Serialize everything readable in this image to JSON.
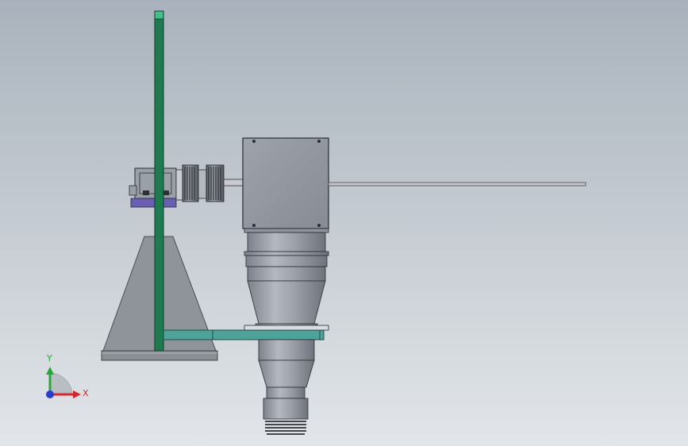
{
  "viewport": {
    "background_top": "#a9b2bc",
    "background_bottom": "#e2e6ea"
  },
  "colors": {
    "post": "#1f7a4f",
    "post_top": "#45c08a",
    "cross_arm": "#4da39a",
    "mount_block": "#6a5fb5",
    "base_plate": "#8a8f96",
    "body_grey": "#8e939c"
  },
  "triad": {
    "x_label": "X",
    "y_label": "Y",
    "x_color": "#d8262e",
    "y_color": "#26a83a",
    "z_color": "#2a3bd0"
  }
}
